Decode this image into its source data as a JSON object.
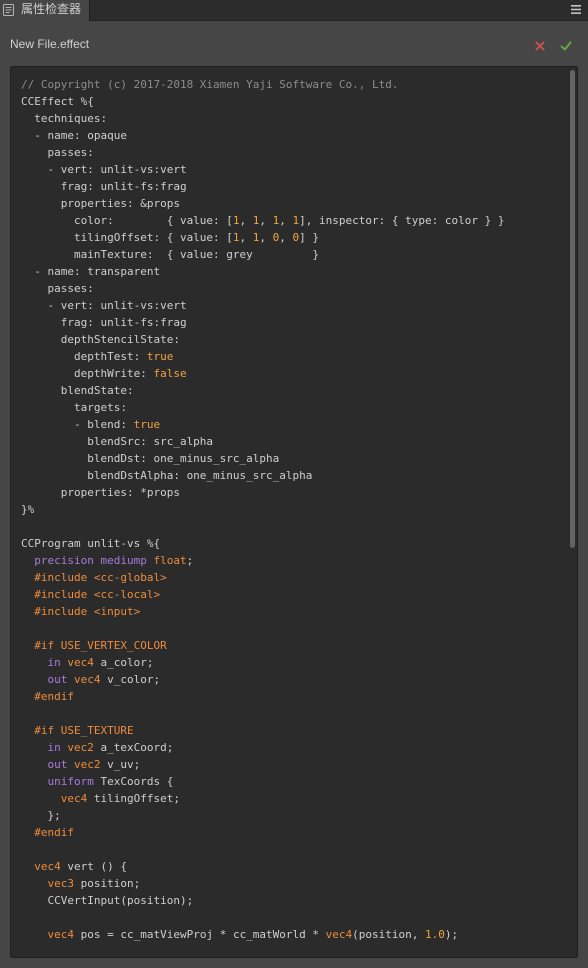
{
  "tab": {
    "title": "属性检查器",
    "icon": "inspector-icon"
  },
  "panel_menu": {
    "icon": "menu-icon"
  },
  "header": {
    "filename": "New File.effect",
    "revert_icon": "close-icon",
    "apply_icon": "check-icon"
  },
  "colors": {
    "revert": "#c4524f",
    "apply": "#62a64a"
  },
  "syntax_colors": {
    "plain": "#cfcfcf",
    "comment": "#8d8d8d",
    "literal": "#f2a43e",
    "keyword": "#a67bdb",
    "directive": "#ee8c3c",
    "type": "#ee8c3c"
  },
  "editor": {
    "lines": [
      [
        [
          "comment",
          "// Copyright (c) 2017-2018 Xiamen Yaji Software Co., Ltd."
        ]
      ],
      [
        [
          "plain",
          "CCEffect %{"
        ]
      ],
      [
        [
          "plain",
          "  techniques:"
        ]
      ],
      [
        [
          "plain",
          "  - name: opaque"
        ]
      ],
      [
        [
          "plain",
          "    passes:"
        ]
      ],
      [
        [
          "plain",
          "    - vert: unlit-vs:vert"
        ]
      ],
      [
        [
          "plain",
          "      frag: unlit-fs:frag"
        ]
      ],
      [
        [
          "plain",
          "      properties: &props"
        ]
      ],
      [
        [
          "plain",
          "        color:        { value: ["
        ],
        [
          "literal",
          "1"
        ],
        [
          "plain",
          ", "
        ],
        [
          "literal",
          "1"
        ],
        [
          "plain",
          ", "
        ],
        [
          "literal",
          "1"
        ],
        [
          "plain",
          ", "
        ],
        [
          "literal",
          "1"
        ],
        [
          "plain",
          "], inspector: { type: color } }"
        ]
      ],
      [
        [
          "plain",
          "        tilingOffset: { value: ["
        ],
        [
          "literal",
          "1"
        ],
        [
          "plain",
          ", "
        ],
        [
          "literal",
          "1"
        ],
        [
          "plain",
          ", "
        ],
        [
          "literal",
          "0"
        ],
        [
          "plain",
          ", "
        ],
        [
          "literal",
          "0"
        ],
        [
          "plain",
          "] }"
        ]
      ],
      [
        [
          "plain",
          "        mainTexture:  { value: grey         }"
        ]
      ],
      [
        [
          "plain",
          "  - name: transparent"
        ]
      ],
      [
        [
          "plain",
          "    passes:"
        ]
      ],
      [
        [
          "plain",
          "    - vert: unlit-vs:vert"
        ]
      ],
      [
        [
          "plain",
          "      frag: unlit-fs:frag"
        ]
      ],
      [
        [
          "plain",
          "      depthStencilState:"
        ]
      ],
      [
        [
          "plain",
          "        depthTest: "
        ],
        [
          "literal",
          "true"
        ]
      ],
      [
        [
          "plain",
          "        depthWrite: "
        ],
        [
          "literal",
          "false"
        ]
      ],
      [
        [
          "plain",
          "      blendState:"
        ]
      ],
      [
        [
          "plain",
          "        targets:"
        ]
      ],
      [
        [
          "plain",
          "        - blend: "
        ],
        [
          "literal",
          "true"
        ]
      ],
      [
        [
          "plain",
          "          blendSrc: src_alpha"
        ]
      ],
      [
        [
          "plain",
          "          blendDst: one_minus_src_alpha"
        ]
      ],
      [
        [
          "plain",
          "          blendDstAlpha: one_minus_src_alpha"
        ]
      ],
      [
        [
          "plain",
          "      properties: *props"
        ]
      ],
      [
        [
          "plain",
          "}%"
        ]
      ],
      [],
      [
        [
          "plain",
          "CCProgram unlit-vs %{"
        ]
      ],
      [
        [
          "plain",
          "  "
        ],
        [
          "keyword",
          "precision mediump"
        ],
        [
          "plain",
          " "
        ],
        [
          "type",
          "float"
        ],
        [
          "plain",
          ";"
        ]
      ],
      [
        [
          "plain",
          "  "
        ],
        [
          "directive",
          "#include <cc-global>"
        ]
      ],
      [
        [
          "plain",
          "  "
        ],
        [
          "directive",
          "#include <cc-local>"
        ]
      ],
      [
        [
          "plain",
          "  "
        ],
        [
          "directive",
          "#include <input>"
        ]
      ],
      [],
      [
        [
          "plain",
          "  "
        ],
        [
          "directive",
          "#if USE_VERTEX_COLOR"
        ]
      ],
      [
        [
          "plain",
          "    "
        ],
        [
          "keyword",
          "in"
        ],
        [
          "plain",
          " "
        ],
        [
          "type",
          "vec4"
        ],
        [
          "plain",
          " a_color;"
        ]
      ],
      [
        [
          "plain",
          "    "
        ],
        [
          "keyword",
          "out"
        ],
        [
          "plain",
          " "
        ],
        [
          "type",
          "vec4"
        ],
        [
          "plain",
          " v_color;"
        ]
      ],
      [
        [
          "plain",
          "  "
        ],
        [
          "directive",
          "#endif"
        ]
      ],
      [],
      [
        [
          "plain",
          "  "
        ],
        [
          "directive",
          "#if USE_TEXTURE"
        ]
      ],
      [
        [
          "plain",
          "    "
        ],
        [
          "keyword",
          "in"
        ],
        [
          "plain",
          " "
        ],
        [
          "type",
          "vec2"
        ],
        [
          "plain",
          " a_texCoord;"
        ]
      ],
      [
        [
          "plain",
          "    "
        ],
        [
          "keyword",
          "out"
        ],
        [
          "plain",
          " "
        ],
        [
          "type",
          "vec2"
        ],
        [
          "plain",
          " v_uv;"
        ]
      ],
      [
        [
          "plain",
          "    "
        ],
        [
          "keyword",
          "uniform"
        ],
        [
          "plain",
          " TexCoords {"
        ]
      ],
      [
        [
          "plain",
          "      "
        ],
        [
          "type",
          "vec4"
        ],
        [
          "plain",
          " tilingOffset;"
        ]
      ],
      [
        [
          "plain",
          "    };"
        ]
      ],
      [
        [
          "plain",
          "  "
        ],
        [
          "directive",
          "#endif"
        ]
      ],
      [],
      [
        [
          "plain",
          "  "
        ],
        [
          "type",
          "vec4"
        ],
        [
          "plain",
          " vert () {"
        ]
      ],
      [
        [
          "plain",
          "    "
        ],
        [
          "type",
          "vec3"
        ],
        [
          "plain",
          " position;"
        ]
      ],
      [
        [
          "plain",
          "    CCVertInput(position);"
        ]
      ],
      [],
      [
        [
          "plain",
          "    "
        ],
        [
          "type",
          "vec4"
        ],
        [
          "plain",
          " pos = cc_matViewProj * cc_matWorld * "
        ],
        [
          "type",
          "vec4"
        ],
        [
          "plain",
          "(position, "
        ],
        [
          "literal",
          "1.0"
        ],
        [
          "plain",
          ");"
        ]
      ]
    ]
  }
}
